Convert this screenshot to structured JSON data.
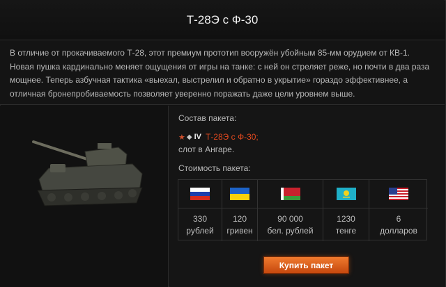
{
  "title": "Т-28Э с Ф-30",
  "description": "В отличие от прокачиваемого Т-28, этот премиум прототип вооружён убойным 85-мм орудием от КВ-1. Новая пушка кардинально меняет ощущения от игры на танке: с ней он стреляет реже, но почти в два раза мощнее. Теперь азбучная тактика «выехал, выстрелил и обратно в укрытие» гораздо эффективнее, а отличная бронепробиваемость позволяет уверенно поражать даже цели уровнем выше.",
  "package": {
    "contents_label": "Состав пакета:",
    "tier": "IV",
    "tank_name": "Т-28Э с Ф-30;",
    "slot_text": "слот в Ангаре.",
    "price_label": "Стоимость пакета:",
    "prices": [
      {
        "flag": "russia-flag-icon",
        "amount": "330",
        "currency": "рублей"
      },
      {
        "flag": "ukraine-flag-icon",
        "amount": "120",
        "currency": "гривен"
      },
      {
        "flag": "belarus-flag-icon",
        "amount": "90 000",
        "currency": "бел. рублей"
      },
      {
        "flag": "kazakhstan-flag-icon",
        "amount": "1230",
        "currency": "тенге"
      },
      {
        "flag": "usa-flag-icon",
        "amount": "6",
        "currency": "долларов"
      }
    ]
  },
  "buy_button": "Купить пакет",
  "colors": {
    "accent": "#e2491f",
    "button": "#e0682a"
  }
}
